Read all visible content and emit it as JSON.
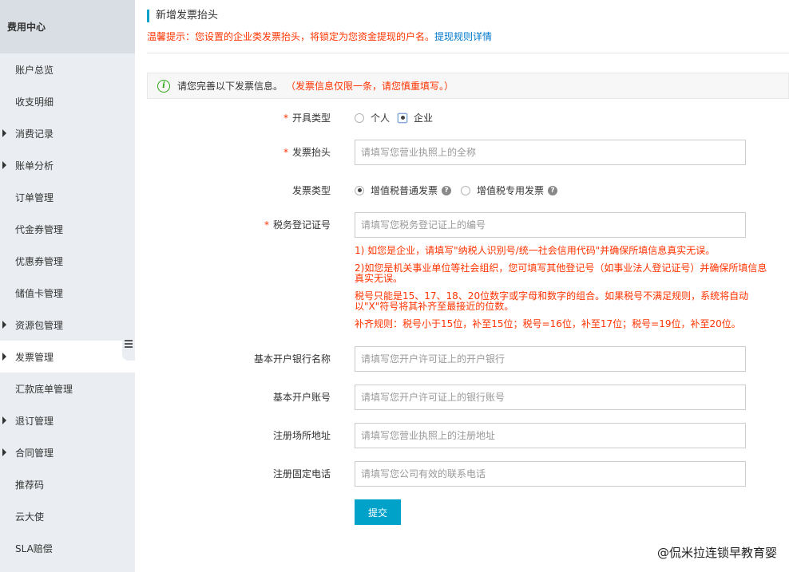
{
  "sidebar": {
    "header": "费用中心",
    "items": [
      {
        "label": "账户总览",
        "caret": false,
        "active": false
      },
      {
        "label": "收支明细",
        "caret": false,
        "active": false
      },
      {
        "label": "消费记录",
        "caret": true,
        "active": false
      },
      {
        "label": "账单分析",
        "caret": true,
        "active": false
      },
      {
        "label": "订单管理",
        "caret": false,
        "active": false
      },
      {
        "label": "代金券管理",
        "caret": false,
        "active": false
      },
      {
        "label": "优惠券管理",
        "caret": false,
        "active": false
      },
      {
        "label": "储值卡管理",
        "caret": false,
        "active": false
      },
      {
        "label": "资源包管理",
        "caret": true,
        "active": false
      },
      {
        "label": "发票管理",
        "caret": true,
        "active": true
      },
      {
        "label": "汇款底单管理",
        "caret": false,
        "active": false
      },
      {
        "label": "退订管理",
        "caret": true,
        "active": false
      },
      {
        "label": "合同管理",
        "caret": true,
        "active": false
      },
      {
        "label": "推荐码",
        "caret": false,
        "active": false
      },
      {
        "label": "云大使",
        "caret": false,
        "active": false
      },
      {
        "label": "SLA赔偿",
        "caret": false,
        "active": false
      }
    ]
  },
  "page": {
    "title": "新增发票抬头",
    "tip_text": "温馨提示：您设置的企业类发票抬头，将锁定为您资金提现的户名。",
    "tip_link": "提现规则详情",
    "notice_main": "请您完善以下发票信息。",
    "notice_warn": "（发票信息仅限一条，请您慎重填写。）"
  },
  "form": {
    "type": {
      "label": "开具类型",
      "required": true,
      "options": [
        "个人",
        "企业"
      ],
      "selected": "企业"
    },
    "header": {
      "label": "发票抬头",
      "required": true,
      "value": "",
      "placeholder": "请填写您营业执照上的全称"
    },
    "invoice_type": {
      "label": "发票类型",
      "required": false,
      "options": [
        "增值税普通发票",
        "增值税专用发票"
      ],
      "selected": "增值税普通发票"
    },
    "tax_no": {
      "label": "税务登记证号",
      "required": true,
      "value": "",
      "placeholder": "请填写您税务登记证上的编号"
    },
    "rules": [
      "1) 如您是企业，请填写\"纳税人识别号/统一社会信用代码\"并确保所填信息真实无误。",
      "2)如您是机关事业单位等社会组织，您可填写其他登记号（如事业法人登记证号）并确保所填信息真实无误。",
      "税号只能是15、17、18、20位数字或字母和数字的组合。如果税号不满足规则，系统将自动以\"X\"符号将其补齐至最接近的位数。",
      "补齐规则：税号小于15位，补至15位；税号=16位，补至17位；税号=19位，补至20位。"
    ],
    "bank_name": {
      "label": "基本开户银行名称",
      "value": "",
      "placeholder": "请填写您开户许可证上的开户银行"
    },
    "bank_account": {
      "label": "基本开户账号",
      "value": "",
      "placeholder": "请填写您开户许可证上的银行账号"
    },
    "address": {
      "label": "注册场所地址",
      "value": "",
      "placeholder": "请填写您营业执照上的注册地址"
    },
    "phone": {
      "label": "注册固定电话",
      "value": "",
      "placeholder": "请填写您公司有效的联系电话"
    },
    "submit_label": "提交"
  },
  "watermark": "@侃米拉连锁早教育婴",
  "colors": {
    "accent": "#00a2ca",
    "warn": "#ff3300",
    "link": "#0077cc",
    "sidebar_bg": "#eaedf1"
  }
}
